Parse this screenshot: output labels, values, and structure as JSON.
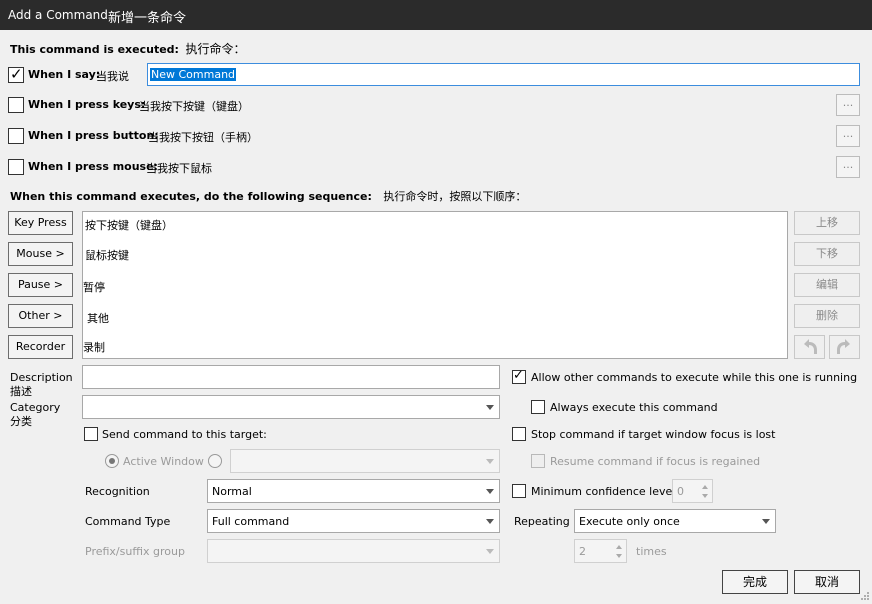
{
  "window": {
    "title": "Add a Command",
    "title_zh": "新增一条命令"
  },
  "header": {
    "label": "This command is executed:",
    "label_zh": "执行命令："
  },
  "triggers": {
    "say": {
      "label": "When I say:",
      "zh": "当我说",
      "value": "New Command",
      "checked": true
    },
    "keys": {
      "label": "When I press keys:",
      "zh": "当我按下按键（键盘）"
    },
    "button": {
      "label": "When I press button:",
      "zh": "当我按下按钮（手柄）"
    },
    "mouse": {
      "label": "When I press mouse:",
      "zh": "当我按下鼠标"
    },
    "dots": "..."
  },
  "sequence": {
    "label": "When this command executes, do the following sequence:",
    "label_zh": "执行命令时，按照以下顺序：",
    "buttons": [
      "Key Press",
      "Mouse >",
      "Pause >",
      "Other >",
      "Recorder"
    ],
    "items": [
      "按下按键（键盘）",
      "鼠标按键",
      "暂停",
      "其他",
      "录制"
    ],
    "right_buttons": [
      "上移",
      "下移",
      "编辑",
      "删除"
    ]
  },
  "description": {
    "label": "Description",
    "zh": "描述",
    "value": ""
  },
  "category": {
    "label": "Category",
    "zh": "分类",
    "value": ""
  },
  "options": {
    "allow_other": {
      "label": "Allow other commands to execute while this one is running",
      "checked": true
    },
    "always_execute": {
      "label": "Always execute this command",
      "checked": false
    },
    "send_target": {
      "label": "Send command to this target:",
      "checked": false
    },
    "active_window": "Active Window",
    "stop_focus": {
      "label": "Stop command if target window focus is lost",
      "checked": false
    },
    "resume_focus": {
      "label": "Resume command if focus is regained",
      "checked": false
    }
  },
  "recognition": {
    "label": "Recognition",
    "value": "Normal"
  },
  "command_type": {
    "label": "Command Type",
    "value": "Full command"
  },
  "prefix_suffix": {
    "label": "Prefix/suffix group",
    "value": ""
  },
  "min_confidence": {
    "label": "Minimum confidence level",
    "value": "0",
    "checked": false
  },
  "repeating": {
    "label": "Repeating",
    "value": "Execute only once",
    "count": "2",
    "unit": "times"
  },
  "footer": {
    "ok": "完成",
    "cancel": "取消"
  },
  "colors": {
    "titlebar": "#2b2b2b",
    "selection": "#0078d7",
    "focus_border": "#3c8dde"
  }
}
